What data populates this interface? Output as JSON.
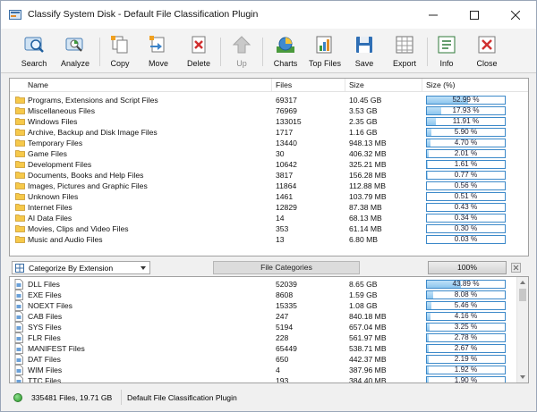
{
  "window": {
    "title": "Classify System Disk - Default File Classification Plugin"
  },
  "toolbar": [
    {
      "name": "search-button",
      "label": "Search",
      "icon": "search-icon",
      "enabled": true
    },
    {
      "name": "analyze-button",
      "label": "Analyze",
      "icon": "analyze-icon",
      "enabled": true
    },
    {
      "name": "copy-button",
      "label": "Copy",
      "icon": "copy-icon",
      "enabled": true
    },
    {
      "name": "move-button",
      "label": "Move",
      "icon": "move-icon",
      "enabled": true
    },
    {
      "name": "delete-button",
      "label": "Delete",
      "icon": "delete-icon",
      "enabled": true
    },
    {
      "name": "up-button",
      "label": "Up",
      "icon": "up-arrow-icon",
      "enabled": false
    },
    {
      "name": "charts-button",
      "label": "Charts",
      "icon": "charts-icon",
      "enabled": true
    },
    {
      "name": "top-files-button",
      "label": "Top Files",
      "icon": "top-files-icon",
      "enabled": true
    },
    {
      "name": "save-button",
      "label": "Save",
      "icon": "save-icon",
      "enabled": true
    },
    {
      "name": "export-button",
      "label": "Export",
      "icon": "export-icon",
      "enabled": true
    },
    {
      "name": "info-button",
      "label": "Info",
      "icon": "info-icon",
      "enabled": true
    },
    {
      "name": "close-button",
      "label": "Close",
      "icon": "close-icon",
      "enabled": true
    }
  ],
  "categories_table": {
    "columns": [
      "Name",
      "Files",
      "Size",
      "Size (%)"
    ],
    "rows": [
      {
        "name": "Programs, Extensions and Script Files",
        "files": "69317",
        "size": "10.45 GB",
        "pct": "52.99 %",
        "fraction": 0.5299
      },
      {
        "name": "Miscellaneous Files",
        "files": "76969",
        "size": "3.53 GB",
        "pct": "17.93 %",
        "fraction": 0.1793
      },
      {
        "name": "Windows Files",
        "files": "133015",
        "size": "2.35 GB",
        "pct": "11.91 %",
        "fraction": 0.1191
      },
      {
        "name": "Archive, Backup and Disk Image Files",
        "files": "1717",
        "size": "1.16 GB",
        "pct": "5.90 %",
        "fraction": 0.059
      },
      {
        "name": "Temporary Files",
        "files": "13440",
        "size": "948.13 MB",
        "pct": "4.70 %",
        "fraction": 0.047
      },
      {
        "name": "Game Files",
        "files": "30",
        "size": "406.32 MB",
        "pct": "2.01 %",
        "fraction": 0.0201
      },
      {
        "name": "Development Files",
        "files": "10642",
        "size": "325.21 MB",
        "pct": "1.61 %",
        "fraction": 0.0161
      },
      {
        "name": "Documents, Books and Help Files",
        "files": "3817",
        "size": "156.28 MB",
        "pct": "0.77 %",
        "fraction": 0.0077
      },
      {
        "name": "Images, Pictures and Graphic Files",
        "files": "11864",
        "size": "112.88 MB",
        "pct": "0.56 %",
        "fraction": 0.0056
      },
      {
        "name": "Unknown Files",
        "files": "1461",
        "size": "103.79 MB",
        "pct": "0.51 %",
        "fraction": 0.0051
      },
      {
        "name": "Internet Files",
        "files": "12829",
        "size": "87.38 MB",
        "pct": "0.43 %",
        "fraction": 0.0043
      },
      {
        "name": "AI Data Files",
        "files": "14",
        "size": "68.13 MB",
        "pct": "0.34 %",
        "fraction": 0.0034
      },
      {
        "name": "Movies, Clips and Video Files",
        "files": "353",
        "size": "61.14 MB",
        "pct": "0.30 %",
        "fraction": 0.003
      },
      {
        "name": "Music and Audio Files",
        "files": "13",
        "size": "6.80 MB",
        "pct": "0.03 %",
        "fraction": 0.0003
      }
    ]
  },
  "middle_bar": {
    "combo_value": "Categorize By Extension",
    "categories_button": "File Categories",
    "total_pct": "100%"
  },
  "extensions_table": {
    "rows": [
      {
        "name": "DLL Files",
        "files": "52039",
        "size": "8.65 GB",
        "pct": "43.89 %",
        "fraction": 0.4389,
        "icon": "dll-file-icon"
      },
      {
        "name": "EXE Files",
        "files": "8608",
        "size": "1.59 GB",
        "pct": "8.08 %",
        "fraction": 0.0808,
        "icon": "exe-file-icon"
      },
      {
        "name": "NOEXT Files",
        "files": "15335",
        "size": "1.08 GB",
        "pct": "5.46 %",
        "fraction": 0.0546,
        "icon": "noext-file-icon"
      },
      {
        "name": "CAB Files",
        "files": "247",
        "size": "840.18 MB",
        "pct": "4.16 %",
        "fraction": 0.0416,
        "icon": "cab-file-icon"
      },
      {
        "name": "SYS Files",
        "files": "5194",
        "size": "657.04 MB",
        "pct": "3.25 %",
        "fraction": 0.0325,
        "icon": "sys-file-icon"
      },
      {
        "name": "FLR Files",
        "files": "228",
        "size": "561.97 MB",
        "pct": "2.78 %",
        "fraction": 0.0278,
        "icon": "flr-file-icon"
      },
      {
        "name": "MANIFEST Files",
        "files": "65449",
        "size": "538.71 MB",
        "pct": "2.67 %",
        "fraction": 0.0267,
        "icon": "manifest-file-icon"
      },
      {
        "name": "DAT Files",
        "files": "650",
        "size": "442.37 MB",
        "pct": "2.19 %",
        "fraction": 0.0219,
        "icon": "dat-file-icon"
      },
      {
        "name": "WIM Files",
        "files": "4",
        "size": "387.96 MB",
        "pct": "1.92 %",
        "fraction": 0.0192,
        "icon": "wim-file-icon"
      },
      {
        "name": "TTC Files",
        "files": "193",
        "size": "384.40 MB",
        "pct": "1.90 %",
        "fraction": 0.019,
        "icon": "ttc-file-icon"
      }
    ]
  },
  "status": {
    "summary": "335481 Files, 19.71 GB",
    "plugin": "Default File Classification Plugin"
  },
  "colors": {
    "accent": "#3c89c9",
    "bar_fill": "#8ec6ee",
    "folder": "#f5c542"
  }
}
